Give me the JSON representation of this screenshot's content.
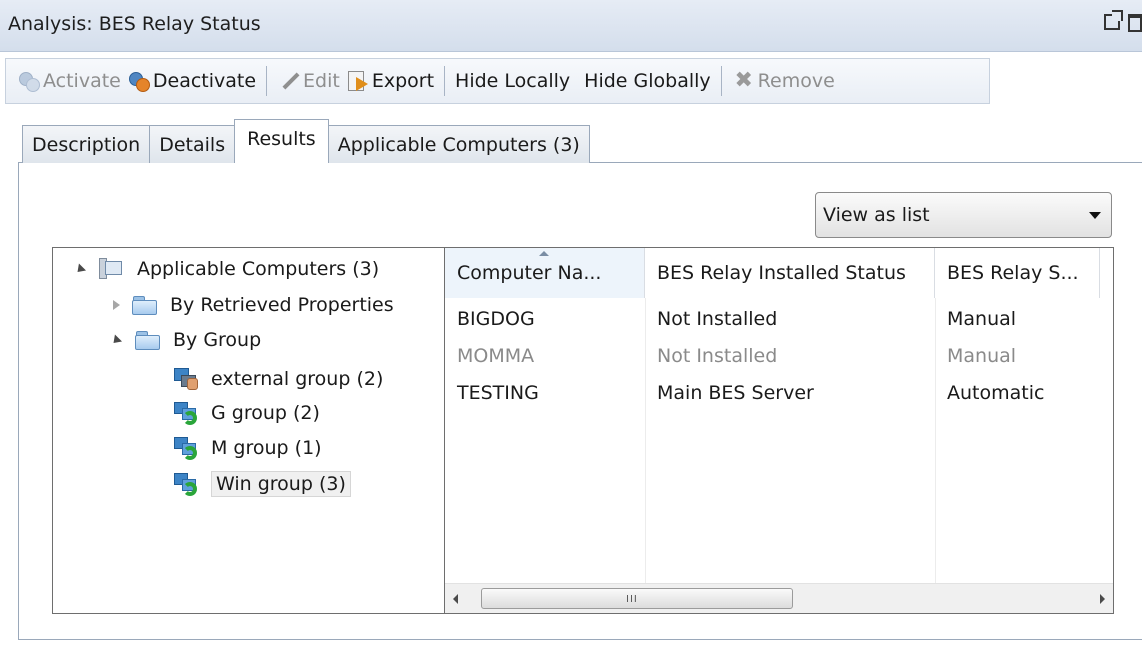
{
  "window": {
    "title": "Analysis: BES Relay Status"
  },
  "toolbar": {
    "activate": "Activate",
    "deactivate": "Deactivate",
    "edit": "Edit",
    "export": "Export",
    "hide_locally": "Hide Locally",
    "hide_globally": "Hide Globally",
    "remove": "Remove"
  },
  "tabs": [
    {
      "label": "Description"
    },
    {
      "label": "Details"
    },
    {
      "label": "Results",
      "active": true
    },
    {
      "label": "Applicable Computers (3)"
    }
  ],
  "view_select": {
    "value": "View as list"
  },
  "tree": {
    "root": "Applicable Computers (3)",
    "by_retrieved": "By Retrieved Properties",
    "by_group": "By Group",
    "groups": [
      {
        "label": "external group (2)",
        "type": "manual"
      },
      {
        "label": "G group (2)",
        "type": "automatic"
      },
      {
        "label": "M group (1)",
        "type": "automatic"
      },
      {
        "label": "Win group (3)",
        "type": "automatic",
        "selected": true
      }
    ]
  },
  "list": {
    "columns": [
      "Computer Na...",
      "BES Relay Installed Status",
      "BES Relay S..."
    ],
    "sorted_column": 0,
    "rows": [
      {
        "cells": [
          "BIGDOG",
          "Not Installed",
          "Manual"
        ],
        "dim": false
      },
      {
        "cells": [
          "MOMMA",
          "Not Installed",
          "Manual"
        ],
        "dim": true
      },
      {
        "cells": [
          "TESTING",
          "Main BES Server",
          "Automatic"
        ],
        "dim": false
      }
    ],
    "scroll_grip": "III"
  }
}
